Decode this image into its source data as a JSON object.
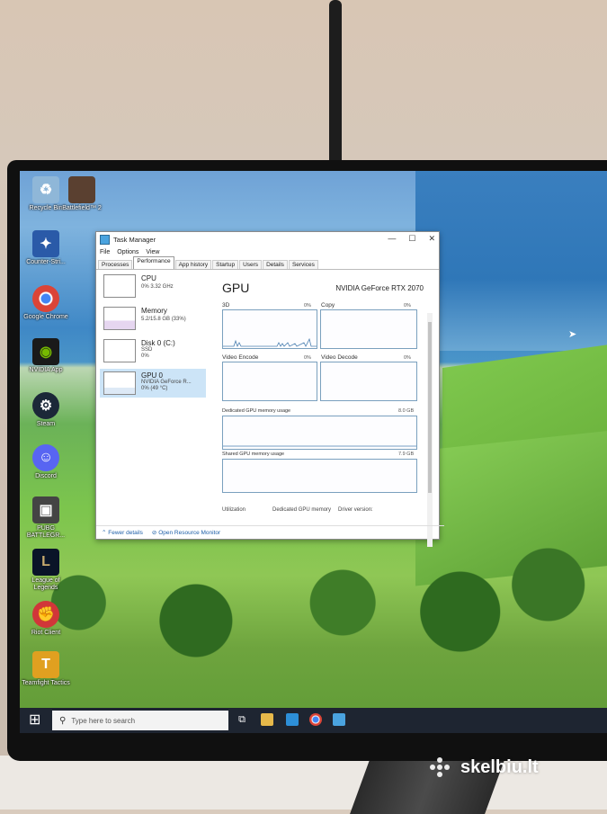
{
  "desktop_icons": [
    {
      "label": "Recycle Bin",
      "icon": "recycle-bin-icon",
      "color": "#8fb7d8"
    },
    {
      "label": "Battlefield™ 2",
      "icon": "battlefield-icon",
      "color": "#5a4030"
    },
    {
      "label": "Counter-Stri...",
      "icon": "counter-strike-icon",
      "color": "#2a5aa8"
    },
    {
      "label": "Google Chrome",
      "icon": "chrome-icon",
      "color": "#db4437"
    },
    {
      "label": "NVIDIA App",
      "icon": "nvidia-icon",
      "color": "#76b900"
    },
    {
      "label": "Steam",
      "icon": "steam-icon",
      "color": "#1b2838"
    },
    {
      "label": "Discord",
      "icon": "discord-icon",
      "color": "#5865f2"
    },
    {
      "label": "PUBG BATTLEGR...",
      "icon": "pubg-icon",
      "color": "#444444"
    },
    {
      "label": "League of Legends",
      "icon": "league-icon",
      "color": "#c8aa6e"
    },
    {
      "label": "Riot Client",
      "icon": "riot-icon",
      "color": "#d13639"
    },
    {
      "label": "Teamfight Tactics",
      "icon": "tft-icon",
      "color": "#e0a020"
    }
  ],
  "task_manager": {
    "title": "Task Manager",
    "controls": {
      "minimize": "—",
      "maximize": "☐",
      "close": "✕"
    },
    "menu": [
      "File",
      "Options",
      "View"
    ],
    "tabs": [
      "Processes",
      "Performance",
      "App history",
      "Startup",
      "Users",
      "Details",
      "Services"
    ],
    "active_tab": "Performance",
    "resources": [
      {
        "name": "CPU",
        "sub1": "0% 3.32 GHz",
        "sub2": ""
      },
      {
        "name": "Memory",
        "sub1": "5.2/15.8 GB (33%)",
        "sub2": ""
      },
      {
        "name": "Disk 0 (C:)",
        "sub1": "SSD",
        "sub2": "0%"
      },
      {
        "name": "GPU 0",
        "sub1": "NVIDIA GeForce R...",
        "sub2": "0% (49 °C)"
      }
    ],
    "gpu": {
      "title": "GPU",
      "model": "NVIDIA GeForce RTX 2070",
      "graphs": [
        {
          "label": "3D",
          "pct": "0%"
        },
        {
          "label": "Copy",
          "pct": "0%"
        },
        {
          "label": "Video Encode",
          "pct": "0%"
        },
        {
          "label": "Video Decode",
          "pct": "0%"
        }
      ],
      "dedicated_label": "Dedicated GPU memory usage",
      "dedicated_max": "8.0 GB",
      "shared_label": "Shared GPU memory usage",
      "shared_max": "7.9 GB",
      "bottom_labels": [
        "Utilization",
        "Dedicated GPU memory",
        "Driver version:"
      ]
    },
    "footer": {
      "fewer": "Fewer details",
      "monitor": "Open Resource Monitor"
    }
  },
  "taskbar": {
    "search_placeholder": "Type here to search"
  },
  "watermark": "skelbiu.lt",
  "colors": {
    "taskbar": "#1e2531",
    "selected_row": "#cce4f7",
    "graph_border": "#7aa0be"
  }
}
